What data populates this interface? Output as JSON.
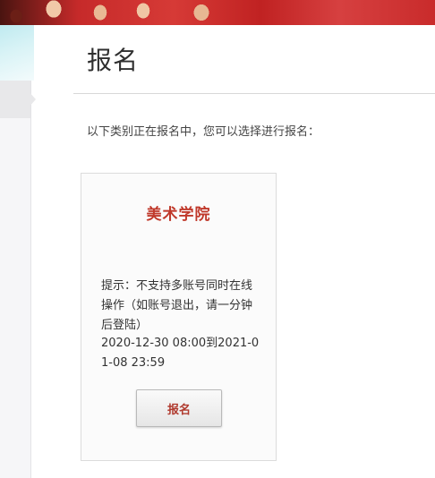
{
  "header": {
    "title": "报名"
  },
  "main": {
    "intro": "以下类别正在报名中，您可以选择进行报名："
  },
  "card": {
    "title": "美术学院",
    "notice": "提示：不支持多账号同时在线操作（如账号退出，请一分钟后登陆）",
    "dates": "2020-12-30 08:00到2021-01-08 23:59",
    "button_label": "报名"
  },
  "colors": {
    "accent": "#c0392b",
    "banner": "#c62a2a",
    "divider": "#d8d8d8"
  }
}
